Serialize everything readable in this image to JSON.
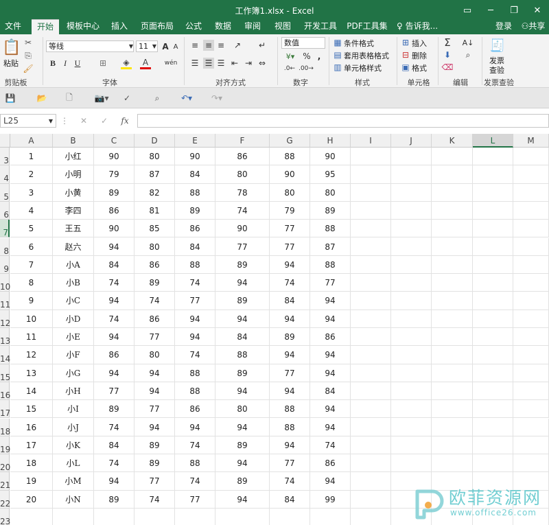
{
  "window": {
    "title": "工作簿1.xlsx - Excel"
  },
  "tabs": [
    "文件",
    "开始",
    "模板中心",
    "插入",
    "页面布局",
    "公式",
    "数据",
    "审阅",
    "视图",
    "开发工具",
    "PDF工具集"
  ],
  "tell_me": "告诉我...",
  "login": "登录",
  "share": "共享",
  "ribbon": {
    "paste": "粘贴",
    "clipboard": "剪贴板",
    "font_name": "等线",
    "font_size": "11",
    "font_group": "字体",
    "align_group": "对齐方式",
    "number_format": "数值",
    "number_group": "数字",
    "cond_format": "条件格式",
    "table_format": "套用表格格式",
    "cell_style": "单元格样式",
    "style_group": "样式",
    "insert": "插入",
    "delete": "删除",
    "format": "格式",
    "cells_group": "单元格",
    "edit_group": "编辑",
    "invoice": "发票",
    "invoice2": "查验",
    "invoice_group": "发票查验",
    "bold": "B",
    "italic": "I",
    "underline": "U"
  },
  "formula_bar": {
    "name_box": "L25",
    "fx": "fx"
  },
  "columns": [
    "A",
    "B",
    "C",
    "D",
    "E",
    "F",
    "G",
    "H",
    "I",
    "J",
    "K",
    "L",
    "M"
  ],
  "selected_column": "L",
  "selected_row": "7",
  "row_numbers": [
    "3",
    "4",
    "5",
    "6",
    "7",
    "8",
    "9",
    "10",
    "11",
    "12",
    "13",
    "14",
    "15",
    "16",
    "17",
    "18",
    "19",
    "20",
    "21",
    "22",
    "23"
  ],
  "rows": [
    [
      "1",
      "小红",
      "90",
      "80",
      "90",
      "86",
      "88",
      "90"
    ],
    [
      "2",
      "小明",
      "79",
      "87",
      "84",
      "80",
      "90",
      "95"
    ],
    [
      "3",
      "小黄",
      "89",
      "82",
      "88",
      "78",
      "80",
      "80"
    ],
    [
      "4",
      "李四",
      "86",
      "81",
      "89",
      "74",
      "79",
      "89"
    ],
    [
      "5",
      "王五",
      "90",
      "85",
      "86",
      "90",
      "77",
      "88"
    ],
    [
      "6",
      "赵六",
      "94",
      "80",
      "84",
      "77",
      "77",
      "87"
    ],
    [
      "7",
      "小A",
      "84",
      "86",
      "88",
      "89",
      "94",
      "88"
    ],
    [
      "8",
      "小B",
      "74",
      "89",
      "74",
      "94",
      "74",
      "77"
    ],
    [
      "9",
      "小C",
      "94",
      "74",
      "77",
      "89",
      "84",
      "94"
    ],
    [
      "10",
      "小D",
      "74",
      "86",
      "94",
      "94",
      "94",
      "94"
    ],
    [
      "11",
      "小E",
      "94",
      "77",
      "94",
      "84",
      "89",
      "86"
    ],
    [
      "12",
      "小F",
      "86",
      "80",
      "74",
      "88",
      "94",
      "94"
    ],
    [
      "13",
      "小G",
      "94",
      "94",
      "88",
      "89",
      "77",
      "94"
    ],
    [
      "14",
      "小H",
      "77",
      "94",
      "88",
      "94",
      "94",
      "84"
    ],
    [
      "15",
      "小I",
      "89",
      "77",
      "86",
      "80",
      "88",
      "94"
    ],
    [
      "16",
      "小J",
      "74",
      "94",
      "94",
      "94",
      "88",
      "94"
    ],
    [
      "17",
      "小K",
      "84",
      "89",
      "74",
      "89",
      "94",
      "74"
    ],
    [
      "18",
      "小L",
      "74",
      "89",
      "88",
      "94",
      "77",
      "86"
    ],
    [
      "19",
      "小M",
      "94",
      "77",
      "74",
      "89",
      "74",
      "94"
    ],
    [
      "20",
      "小N",
      "89",
      "74",
      "77",
      "94",
      "84",
      "99"
    ]
  ],
  "watermark": {
    "text": "欧菲资源网",
    "url": "www.office26.com"
  },
  "colors": {
    "excel_green": "#217346",
    "watermark_teal": "#4fc3c8"
  }
}
